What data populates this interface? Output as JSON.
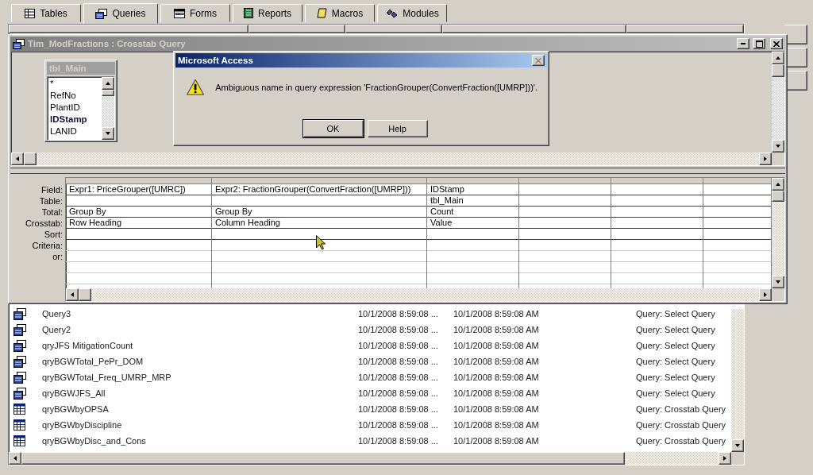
{
  "tabs": [
    {
      "label": "Tables",
      "selected": false
    },
    {
      "label": "Queries",
      "selected": true
    },
    {
      "label": "Forms",
      "selected": false
    },
    {
      "label": "Reports",
      "selected": false
    },
    {
      "label": "Macros",
      "selected": false
    },
    {
      "label": "Modules",
      "selected": false
    }
  ],
  "objects": [
    {
      "name": "Query3",
      "kind": "select",
      "modified": "10/1/2008 8:59:08 ...",
      "created": "10/1/2008 8:59:08 AM",
      "type": "Query: Select Query"
    },
    {
      "name": "Query2",
      "kind": "select",
      "modified": "10/1/2008 8:59:08 ...",
      "created": "10/1/2008 8:59:08 AM",
      "type": "Query: Select Query"
    },
    {
      "name": "qryJFS MitigationCount",
      "kind": "select",
      "modified": "10/1/2008 8:59:08 ...",
      "created": "10/1/2008 8:59:08 AM",
      "type": "Query: Select Query"
    },
    {
      "name": "qryBGWTotal_PePr_DOM",
      "kind": "select",
      "modified": "10/1/2008 8:59:08 ...",
      "created": "10/1/2008 8:59:08 AM",
      "type": "Query: Select Query"
    },
    {
      "name": "qryBGWTotal_Freq_UMRP_MRP",
      "kind": "select",
      "modified": "10/1/2008 8:59:08 ...",
      "created": "10/1/2008 8:59:08 AM",
      "type": "Query: Select Query"
    },
    {
      "name": "qryBGWJFS_All",
      "kind": "select",
      "modified": "10/1/2008 8:59:08 ...",
      "created": "10/1/2008 8:59:08 AM",
      "type": "Query: Select Query"
    },
    {
      "name": "qryBGWbyOPSA",
      "kind": "crosstab",
      "modified": "10/1/2008 8:59:08 ...",
      "created": "10/1/2008 8:59:08 AM",
      "type": "Query: Crosstab Query"
    },
    {
      "name": "qryBGWbyDiscipline",
      "kind": "crosstab",
      "modified": "10/1/2008 8:59:08 ...",
      "created": "10/1/2008 8:59:08 AM",
      "type": "Query: Crosstab Query"
    },
    {
      "name": "qryBGWbyDisc_and_Cons",
      "kind": "crosstab",
      "modified": "10/1/2008 8:59:08 ...",
      "created": "10/1/2008 8:59:08 AM",
      "type": "Query: Crosstab Query"
    }
  ],
  "query_window": {
    "title": "Tim_ModFractions : Crosstab Query",
    "active": false,
    "field_list": {
      "title": "tbl_Main",
      "fields": [
        {
          "label": "*",
          "bold": false
        },
        {
          "label": "RefNo",
          "bold": false
        },
        {
          "label": "PlantID",
          "bold": false
        },
        {
          "label": "IDStamp",
          "bold": true
        },
        {
          "label": "LANID",
          "bold": false
        }
      ]
    },
    "row_labels": [
      "Field:",
      "Table:",
      "Total:",
      "Crosstab:",
      "Sort:",
      "Criteria:",
      "or:"
    ],
    "columns": [
      {
        "field": "Expr1: PriceGrouper([UMRC])",
        "total": "Group By",
        "crosstab": "Row Heading"
      },
      {
        "field": "Expr2: FractionGrouper(ConvertFraction([UMRP]))",
        "total": "Group By",
        "crosstab": "Column Heading"
      },
      {
        "field": "IDStamp",
        "table": "tbl_Main",
        "total": "Count",
        "crosstab": "Value"
      }
    ]
  },
  "dialog": {
    "title": "Microsoft Access",
    "message": "Ambiguous name in query expression 'FractionGrouper(ConvertFraction([UMRP]))'.",
    "buttons": [
      {
        "label": "OK",
        "default": true
      },
      {
        "label": "Help",
        "default": false
      }
    ]
  }
}
